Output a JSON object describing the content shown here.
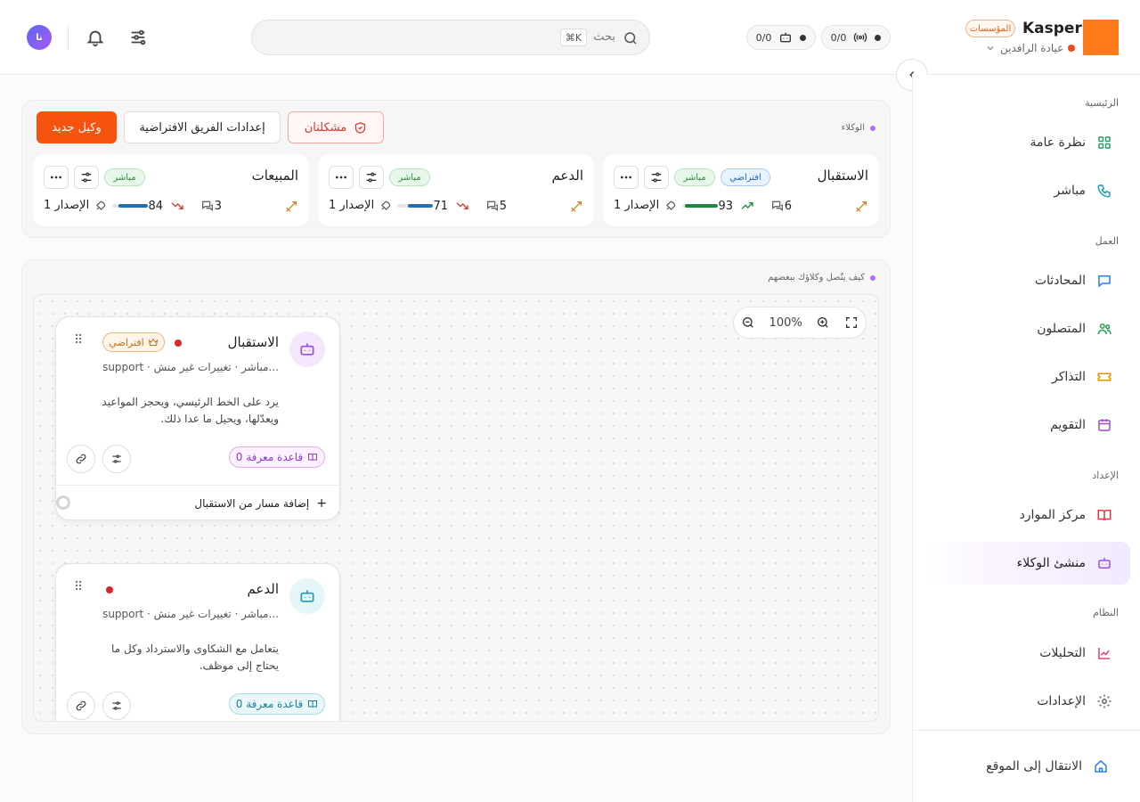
{
  "header": {
    "brand": "Kasper",
    "brand_badge": "المؤسسات",
    "clinic": "عيادة الرافدين",
    "stat_channels": "0/0",
    "stat_bots": "0/0",
    "search_placeholder": "بحث",
    "search_shortcut": "⌘K",
    "avatar_initials": "نا"
  },
  "sidebar": {
    "sections": [
      {
        "title": "الرئيسية"
      },
      {
        "title": "العمل"
      },
      {
        "title": "الإعداد"
      },
      {
        "title": "النظام"
      }
    ],
    "items": [
      {
        "label": "نظرة عامة",
        "icon": "grid-icon"
      },
      {
        "label": "مباشر",
        "icon": "phone-icon"
      },
      {
        "label": "المحادثات",
        "icon": "chat-icon"
      },
      {
        "label": "المتصلون",
        "icon": "users-icon"
      },
      {
        "label": "التذاكر",
        "icon": "ticket-icon"
      },
      {
        "label": "التقويم",
        "icon": "calendar-icon"
      },
      {
        "label": "مركز الموارد",
        "icon": "book-icon"
      },
      {
        "label": "منشئ الوكلاء",
        "icon": "bot-icon"
      },
      {
        "label": "التحليلات",
        "icon": "chart-icon"
      },
      {
        "label": "الإعدادات",
        "icon": "gear-icon"
      }
    ],
    "visit_site": "الانتقال إلى الموقع"
  },
  "agents": {
    "section_label": "الوكلاء",
    "new_agent": "وكيل جديد",
    "team_defaults": "إعدادات الفريق الافتراضية",
    "issues": "مشكلتان",
    "cards": [
      {
        "name": "الاستقبال",
        "badge_default": "افتراضي",
        "badge_live": "مباشر",
        "conversations": "6",
        "score": "93",
        "score_fill": 93,
        "trend": "up",
        "version": "الإصدار 1"
      },
      {
        "name": "الدعم",
        "badge_live": "مباشر",
        "conversations": "5",
        "score": "71",
        "score_fill": 71,
        "trend": "down",
        "version": "الإصدار 1"
      },
      {
        "name": "المبيعات",
        "badge_live": "مباشر",
        "conversations": "3",
        "score": "84",
        "score_fill": 84,
        "trend": "down",
        "version": "الإصدار 1"
      }
    ]
  },
  "flow": {
    "section_label": "كيف يتّصل وكلاؤك ببعضهم",
    "zoom": "100%",
    "nodes": [
      {
        "name": "الاستقبال",
        "default_badge": "افتراضي",
        "subtitle": "support · مباشر · تغييرات غير منش...",
        "description": "يرد على الخط الرئيسي، ويحجز المواعيد ويعدّلها، ويحيل ما عدا ذلك.",
        "knowledge": "0 قاعدة معرفة",
        "add_route": "إضافة مسار من الاستقبال"
      },
      {
        "name": "الدعم",
        "subtitle": "support · مباشر · تغييرات غير منش...",
        "description": "يتعامل مع الشكاوى والاسترداد وكل ما يحتاج إلى موظف.",
        "knowledge": "0 قاعدة معرفة"
      }
    ]
  }
}
